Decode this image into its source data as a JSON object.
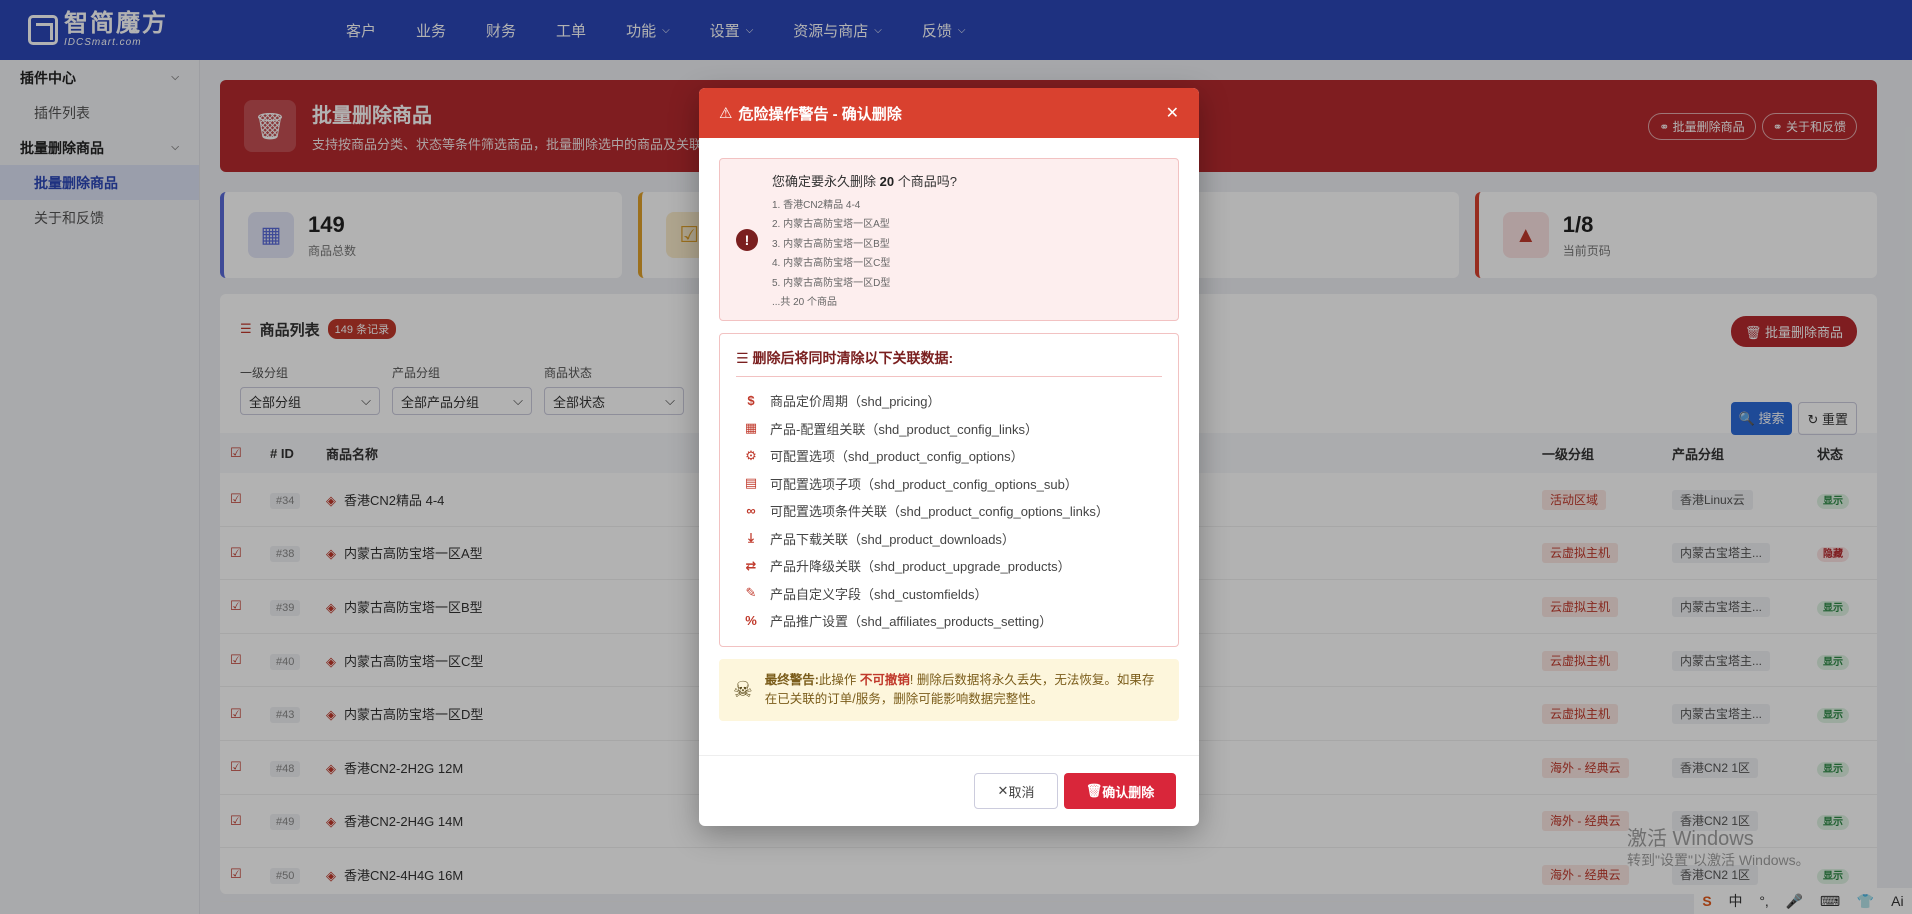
{
  "logo": {
    "cn": "智简魔方",
    "en": "IDCSmart.com"
  },
  "nav": [
    {
      "label": "客户",
      "dropdown": false
    },
    {
      "label": "业务",
      "dropdown": false
    },
    {
      "label": "财务",
      "dropdown": false
    },
    {
      "label": "工单",
      "dropdown": false
    },
    {
      "label": "功能",
      "dropdown": true
    },
    {
      "label": "设置",
      "dropdown": true
    },
    {
      "label": "资源与商店",
      "dropdown": true
    },
    {
      "label": "反馈",
      "dropdown": true
    }
  ],
  "sidebar": {
    "group1": "插件中心",
    "item1": "插件列表",
    "group2": "批量删除商品",
    "item2": "批量删除商品",
    "item3": "关于和反馈"
  },
  "hero": {
    "title": "批量删除商品",
    "desc": "支持按商品分类、状态等条件筛选商品，批量删除选中的商品及关联",
    "btn1": "批量删除商品",
    "btn2": "关于和反馈"
  },
  "stats": [
    {
      "value": "149",
      "label": "商品总数"
    },
    {
      "value": "",
      "label": ""
    },
    {
      "value": "",
      "label": ""
    },
    {
      "value": "1/8",
      "label": "当前页码"
    }
  ],
  "list": {
    "title": "商品列表",
    "badge": "149 条记录",
    "bulk_btn": "批量删除商品",
    "filters": [
      {
        "label": "一级分组",
        "value": "全部分组"
      },
      {
        "label": "产品分组",
        "value": "全部产品分组"
      },
      {
        "label": "商品状态",
        "value": "全部状态"
      }
    ],
    "search_btn": "搜索",
    "reset_btn": "重置",
    "headers": {
      "id": "ID",
      "name": "商品名称",
      "g1": "一级分组",
      "g2": "产品分组",
      "status": "状态"
    },
    "rows": [
      {
        "id": "#34",
        "name": "香港CN2精品 4-4",
        "g1": "活动区域",
        "g2": "香港Linux云",
        "status": "显示"
      },
      {
        "id": "#38",
        "name": "内蒙古高防宝塔一区A型",
        "g1": "云虚拟主机",
        "g2": "内蒙古宝塔主...",
        "status": "隐藏"
      },
      {
        "id": "#39",
        "name": "内蒙古高防宝塔一区B型",
        "g1": "云虚拟主机",
        "g2": "内蒙古宝塔主...",
        "status": "显示"
      },
      {
        "id": "#40",
        "name": "内蒙古高防宝塔一区C型",
        "g1": "云虚拟主机",
        "g2": "内蒙古宝塔主...",
        "status": "显示"
      },
      {
        "id": "#43",
        "name": "内蒙古高防宝塔一区D型",
        "g1": "云虚拟主机",
        "g2": "内蒙古宝塔主...",
        "status": "显示"
      },
      {
        "id": "#48",
        "name": "香港CN2-2H2G 12M",
        "g1": "海外 - 经典云",
        "g2": "香港CN2 1区",
        "status": "显示"
      },
      {
        "id": "#49",
        "name": "香港CN2-2H4G 14M",
        "g1": "海外 - 经典云",
        "g2": "香港CN2 1区",
        "status": "显示"
      },
      {
        "id": "#50",
        "name": "香港CN2-4H4G 16M",
        "g1": "海外 - 经典云",
        "g2": "香港CN2 1区",
        "status": "显示"
      }
    ]
  },
  "modal": {
    "title": "危险操作警告 - 确认删除",
    "q_prefix": "您确定要永久删除",
    "q_count": "20",
    "q_suffix": "个商品吗?",
    "items": [
      "1. 香港CN2精品 4-4",
      "2. 内蒙古高防宝塔一区A型",
      "3. 内蒙古高防宝塔一区B型",
      "4. 内蒙古高防宝塔一区C型",
      "5. 内蒙古高防宝塔一区D型"
    ],
    "more": "...共 20 个商品",
    "related_title": "删除后将同时清除以下关联数据:",
    "related": [
      {
        "icon": "dollar-icon",
        "glyph": "$",
        "text": "商品定价周期（shd_pricing）"
      },
      {
        "icon": "grid-icon",
        "glyph": "▦",
        "text": "产品-配置组关联（shd_product_config_links）"
      },
      {
        "icon": "cogs-icon",
        "glyph": "⚙",
        "text": "可配置选项（shd_product_config_options）"
      },
      {
        "icon": "list-box-icon",
        "glyph": "▤",
        "text": "可配置选项子项（shd_product_config_options_sub）"
      },
      {
        "icon": "link-icon",
        "glyph": "∞",
        "text": "可配置选项条件关联（shd_product_config_options_links）"
      },
      {
        "icon": "download-icon",
        "glyph": "⤓",
        "text": "产品下载关联（shd_product_downloads）"
      },
      {
        "icon": "exchange-icon",
        "glyph": "⇄",
        "text": "产品升降级关联（shd_product_upgrade_products）"
      },
      {
        "icon": "pencil-icon",
        "glyph": "✎",
        "text": "产品自定义字段（shd_customfields）"
      },
      {
        "icon": "percent-icon",
        "glyph": "%",
        "text": "产品推广设置（shd_affiliates_products_setting）"
      }
    ],
    "final_label": "最终警告:",
    "final_pre": "此操作",
    "final_danger": "不可撤销",
    "final_rest": "! 删除后数据将永久丢失，无法恢复。如果存在已关联的订单/服务，删除可能影响数据完整性。",
    "cancel": "取消",
    "confirm": "确认删除"
  },
  "watermark": {
    "title": "激活 Windows",
    "sub": "转到\"设置\"以激活 Windows。"
  },
  "taskbar": [
    "中",
    "°,",
    "Ai"
  ],
  "colors": {
    "nav": "#2b47b8",
    "danger": "#d9412f",
    "confirm": "#d9263a"
  }
}
